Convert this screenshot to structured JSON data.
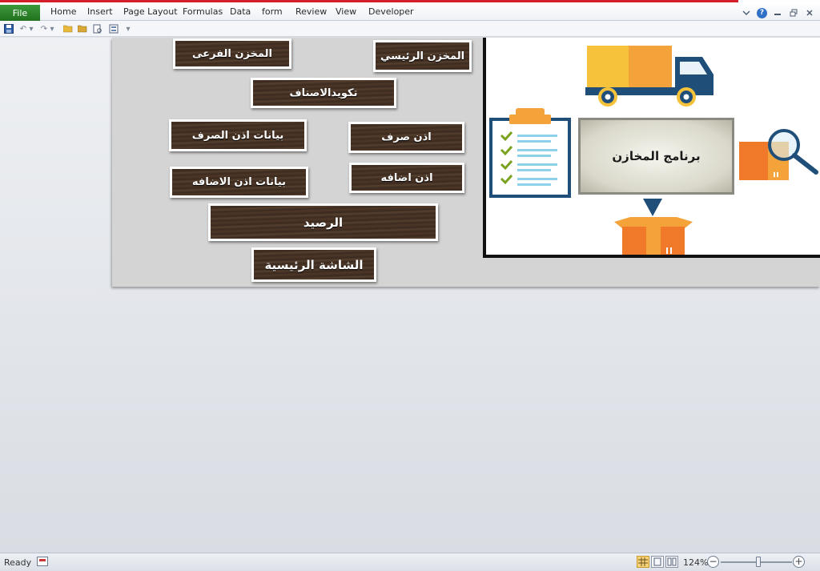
{
  "ribbon": {
    "file_label": "File",
    "tabs": [
      "Home",
      "Insert",
      "Page Layout",
      "Formulas",
      "Data",
      "form",
      "Review",
      "View",
      "Developer"
    ]
  },
  "sheet": {
    "buttons": {
      "main_store": "المخزن الرئيسي",
      "sub_store": "المخزن الفرعى",
      "item_coding": "تكويدالاصناف",
      "issue_permit": "اذن صرف",
      "issue_permit_data": "بيانات اذن الصرف",
      "add_permit": "اذن اضافه",
      "add_permit_data": "بيانات اذن الاضافه",
      "balance": "الرصيد",
      "home_screen": "الشاشة الرئيسية"
    },
    "picture": {
      "center_title": "برنامج المخازن",
      "icons": [
        "truck-icon",
        "clipboard-checklist-icon",
        "magnifier-box-icon",
        "down-arrow-icon",
        "open-box-icon"
      ]
    }
  },
  "status": {
    "ready": "Ready",
    "zoom": "124%",
    "zoom_level_percent": 124
  },
  "colors": {
    "file_tab": "#2e7d2b",
    "wood": "#4a3426",
    "truck_cab": "#1f4e79",
    "box_orange": "#f07a2a",
    "cargo_orange": "#f4a23a",
    "check_green": "#7aa21e"
  }
}
